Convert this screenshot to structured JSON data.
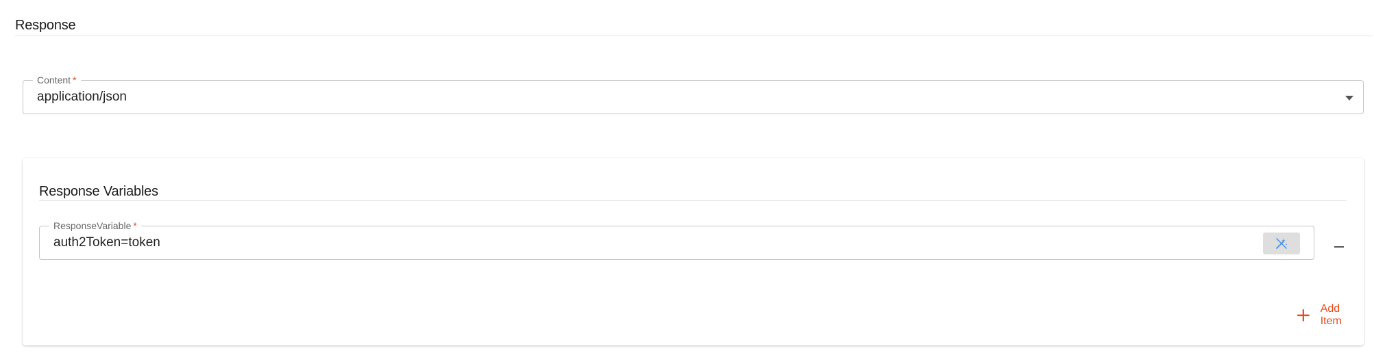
{
  "response": {
    "title": "Response",
    "content_field": {
      "label": "Content",
      "required_mark": "*",
      "value": "application/json"
    },
    "variables_card": {
      "title": "Response Variables",
      "variable_field": {
        "label": "ResponseVariable",
        "required_mark": "*",
        "value": "auth2Token=token"
      },
      "add_item_label": "Add Item"
    }
  },
  "icons": {
    "dropdown": "chevron-down-icon",
    "magic": "magic-wand-off-icon",
    "remove": "minus-icon",
    "add": "plus-icon"
  },
  "colors": {
    "accent": "#e64a19",
    "required": "#e0471d",
    "wand": "#4a90e2"
  }
}
